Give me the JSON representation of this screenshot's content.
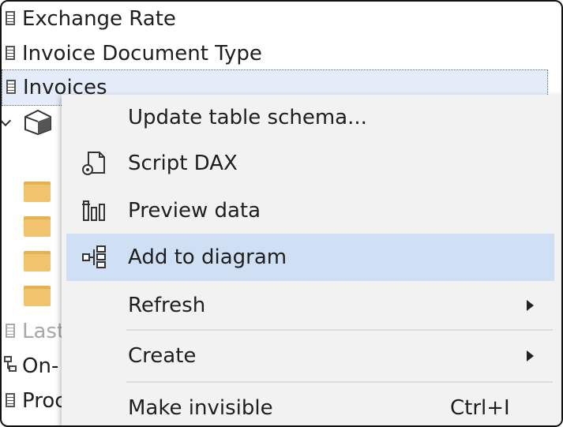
{
  "tree": {
    "rows": [
      {
        "label": "Exchange Rate"
      },
      {
        "label": "Invoice Document Type"
      },
      {
        "label": "Invoices"
      },
      {
        "label": "Last"
      },
      {
        "label": "On-"
      },
      {
        "label": "Proc"
      }
    ]
  },
  "context_menu": {
    "items": [
      {
        "label": "Update table schema...",
        "icon": "none"
      },
      {
        "label": "Script DAX",
        "icon": "script-icon"
      },
      {
        "label": "Preview data",
        "icon": "preview-data-icon"
      },
      {
        "label": "Add to diagram",
        "icon": "diagram-icon",
        "highlighted": true
      },
      {
        "label": "Refresh",
        "submenu": true
      },
      {
        "label": "Create",
        "submenu": true
      },
      {
        "label": "Make invisible",
        "shortcut": "Ctrl+I"
      }
    ]
  },
  "colors": {
    "highlight": "#cfe0f4",
    "selected_row": "#e3ecf8",
    "folder": "#f0c36c"
  }
}
